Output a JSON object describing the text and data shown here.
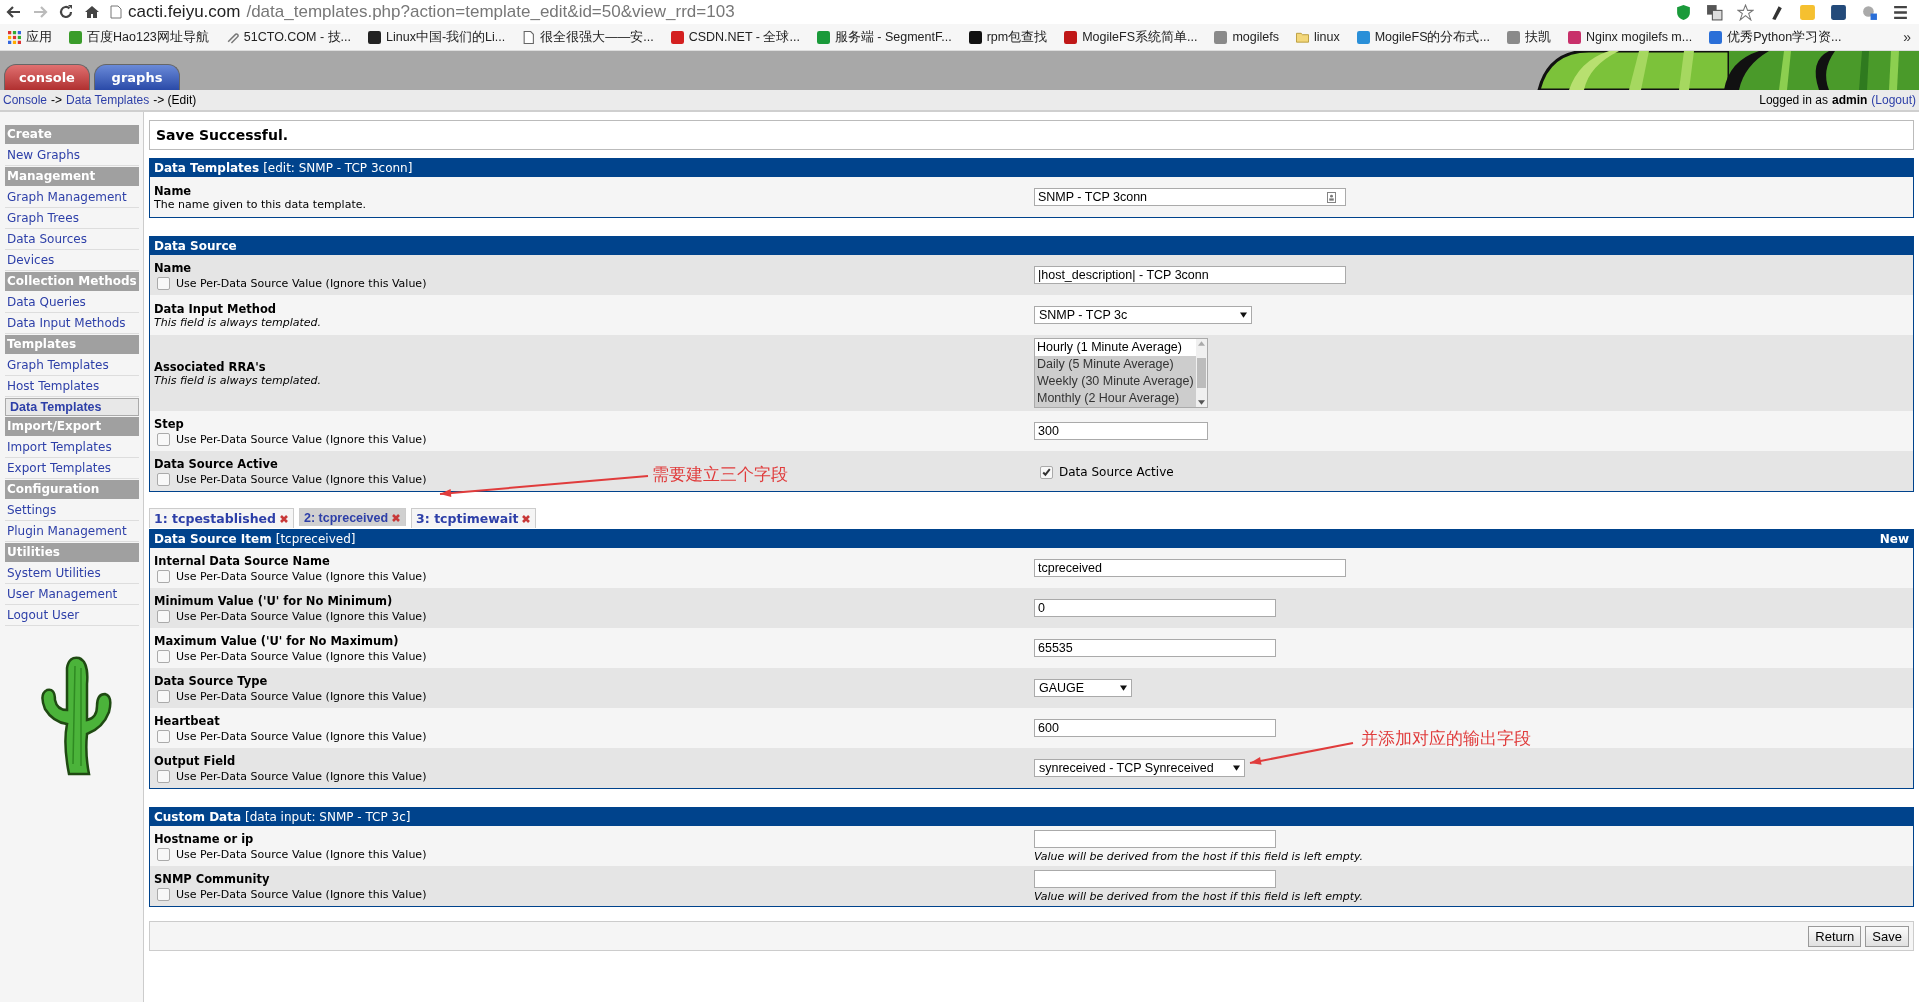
{
  "browser": {
    "url_host": "cacti.feiyu.com",
    "url_path": "/data_templates.php?action=template_edit&id=50&view_rrd=103",
    "bookmarks": [
      {
        "label": "应用",
        "kind": "apps"
      },
      {
        "label": "百度Hao123网址导航",
        "kind": "site",
        "color": "#3a9c2a"
      },
      {
        "label": "51CTO.COM - 技...",
        "kind": "clip"
      },
      {
        "label": "Linux中国-我们的Li...",
        "kind": "site",
        "color": "#222222"
      },
      {
        "label": "很全很强大——安...",
        "kind": "page"
      },
      {
        "label": "CSDN.NET - 全球...",
        "kind": "site",
        "color": "#d42020"
      },
      {
        "label": "服务端 - SegmentF...",
        "kind": "site",
        "color": "#1a9a3a"
      },
      {
        "label": "rpm包查找",
        "kind": "site",
        "color": "#111111"
      },
      {
        "label": "MogileFS系统简单...",
        "kind": "site",
        "color": "#c01818"
      },
      {
        "label": "mogilefs",
        "kind": "site",
        "color": "#8a8a8a"
      },
      {
        "label": "linux",
        "kind": "folder"
      },
      {
        "label": "MogileFS的分布式...",
        "kind": "site",
        "color": "#2a8fd8"
      },
      {
        "label": "扶凯",
        "kind": "site",
        "color": "#8a8a8a"
      },
      {
        "label": "Nginx mogilefs m...",
        "kind": "site",
        "color": "#c8306a"
      },
      {
        "label": "优秀Python学习资...",
        "kind": "site",
        "color": "#2a6fd8"
      }
    ],
    "more": "»"
  },
  "header": {
    "tabs": [
      {
        "label": "console",
        "selected": true
      },
      {
        "label": "graphs",
        "selected": false
      }
    ]
  },
  "breadcrumb": [
    {
      "text": "Console",
      "kind": "link"
    },
    {
      "text": "->",
      "kind": "sep"
    },
    {
      "text": "Data Templates",
      "kind": "link"
    },
    {
      "text": "-> (Edit)",
      "kind": "sep"
    }
  ],
  "login": {
    "text": "Logged in as",
    "user": "admin",
    "logout": "(Logout)"
  },
  "sidebar": [
    {
      "title": "Create",
      "items": [
        {
          "label": "New Graphs",
          "selected": false
        }
      ]
    },
    {
      "title": "Management",
      "items": [
        {
          "label": "Graph Management",
          "selected": false
        },
        {
          "label": "Graph Trees",
          "selected": false
        },
        {
          "label": "Data Sources",
          "selected": false
        },
        {
          "label": "Devices",
          "selected": false
        }
      ]
    },
    {
      "title": "Collection Methods",
      "items": [
        {
          "label": "Data Queries",
          "selected": false
        },
        {
          "label": "Data Input Methods",
          "selected": false
        }
      ]
    },
    {
      "title": "Templates",
      "items": [
        {
          "label": "Graph Templates",
          "selected": false
        },
        {
          "label": "Host Templates",
          "selected": false
        },
        {
          "label": "Data Templates",
          "selected": true
        }
      ]
    },
    {
      "title": "Import/Export",
      "items": [
        {
          "label": "Import Templates",
          "selected": false
        },
        {
          "label": "Export Templates",
          "selected": false
        }
      ]
    },
    {
      "title": "Configuration",
      "items": [
        {
          "label": "Settings",
          "selected": false
        },
        {
          "label": "Plugin Management",
          "selected": false
        }
      ]
    },
    {
      "title": "Utilities",
      "items": [
        {
          "label": "System Utilities",
          "selected": false
        },
        {
          "label": "User Management",
          "selected": false
        },
        {
          "label": "Logout User",
          "selected": false
        }
      ]
    }
  ],
  "message": "Save Successful.",
  "forms": [
    {
      "title": "Data Templates",
      "detail": "[edit: SNMP - TCP 3conn]",
      "rows": [
        {
          "label": "Name",
          "description": "The name given to this data template.",
          "field": {
            "kind": "text",
            "value": "SNMP - TCP 3conn",
            "icon": true
          }
        }
      ]
    },
    {
      "title": "Data Source",
      "rows": [
        {
          "label": "Name",
          "per_ds": {
            "label": "Use Per-Data Source Value (Ignore this Value)",
            "checked": false
          },
          "field": {
            "kind": "text",
            "value": "|host_description| - TCP 3conn"
          }
        },
        {
          "label": "Data Input Method",
          "note": "This field is always templated.",
          "field": {
            "kind": "select",
            "value": "SNMP - TCP 3c"
          }
        },
        {
          "label": "Associated RRA's",
          "note": "This field is always templated.",
          "field": {
            "kind": "listbox",
            "options": [
              {
                "text": "Hourly (1 Minute Average)",
                "selected": false
              },
              {
                "text": "Daily (5 Minute Average)",
                "selected": true
              },
              {
                "text": "Weekly (30 Minute Average)",
                "selected": true
              },
              {
                "text": "Monthly (2 Hour Average)",
                "selected": true
              }
            ]
          }
        },
        {
          "label": "Step",
          "per_ds": {
            "label": "Use Per-Data Source Value (Ignore this Value)",
            "checked": false
          },
          "field": {
            "kind": "text",
            "value": "300"
          }
        },
        {
          "label": "Data Source Active",
          "per_ds": {
            "label": "Use Per-Data Source Value (Ignore this Value)",
            "checked": false
          },
          "field": {
            "kind": "checkbox",
            "label": "Data Source Active",
            "checked": true
          }
        }
      ]
    },
    {
      "tabs": [
        {
          "label": "1: tcpestablished",
          "selected": false
        },
        {
          "label": "2: tcpreceived",
          "selected": true
        },
        {
          "label": "3: tcptimewait",
          "selected": false
        }
      ],
      "title": "Data Source Item",
      "detail": "[tcpreceived]",
      "action": "New",
      "rows": [
        {
          "label": "Internal Data Source Name",
          "per_ds": {
            "label": "Use Per-Data Source Value (Ignore this Value)",
            "checked": false
          },
          "field": {
            "kind": "text",
            "value": "tcpreceived"
          }
        },
        {
          "label": "Minimum Value ('U' for No Minimum)",
          "per_ds": {
            "label": "Use Per-Data Source Value (Ignore this Value)",
            "checked": false
          },
          "field": {
            "kind": "text",
            "value": "0"
          }
        },
        {
          "label": "Maximum Value ('U' for No Maximum)",
          "per_ds": {
            "label": "Use Per-Data Source Value (Ignore this Value)",
            "checked": false
          },
          "field": {
            "kind": "text",
            "value": "65535"
          }
        },
        {
          "label": "Data Source Type",
          "per_ds": {
            "label": "Use Per-Data Source Value (Ignore this Value)",
            "checked": false
          },
          "field": {
            "kind": "select",
            "value": "GAUGE"
          }
        },
        {
          "label": "Heartbeat",
          "per_ds": {
            "label": "Use Per-Data Source Value (Ignore this Value)",
            "checked": false
          },
          "field": {
            "kind": "text",
            "value": "600"
          }
        },
        {
          "label": "Output Field",
          "per_ds": {
            "label": "Use Per-Data Source Value (Ignore this Value)",
            "checked": false
          },
          "field": {
            "kind": "select",
            "value": "synreceived - TCP Synreceived"
          }
        }
      ]
    },
    {
      "title": "Custom Data",
      "detail": "[data input: SNMP - TCP 3c]",
      "rows": [
        {
          "label": "Hostname or ip",
          "per_ds": {
            "label": "Use Per-Data Source Value (Ignore this Value)",
            "checked": false
          },
          "field": {
            "kind": "text",
            "hint": "Value will be derived from the host if this field is left empty."
          }
        },
        {
          "label": "SNMP Community",
          "per_ds": {
            "label": "Use Per-Data Source Value (Ignore this Value)",
            "checked": false
          },
          "field": {
            "kind": "text",
            "hint": "Value will be derived from the host if this field is left empty."
          }
        }
      ]
    }
  ],
  "buttons": [
    {
      "label": "Return"
    },
    {
      "label": "Save"
    }
  ],
  "annotations": [
    {
      "text": "需要建立三个字段"
    },
    {
      "text": "并添加对应的输出字段"
    }
  ]
}
